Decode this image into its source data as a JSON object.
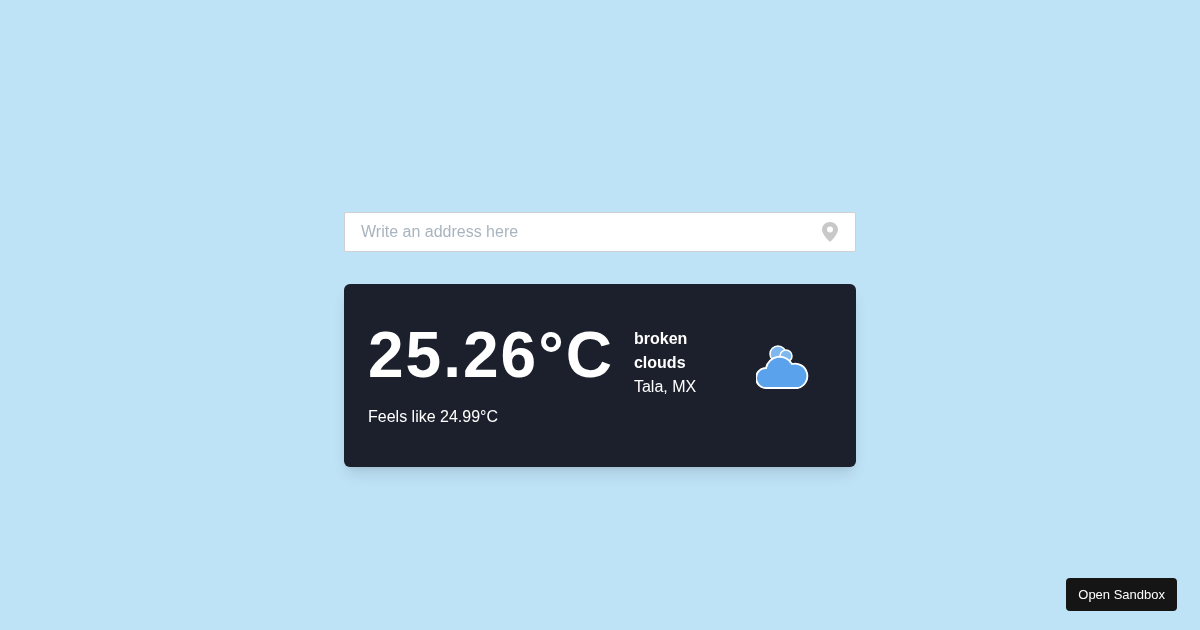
{
  "search": {
    "placeholder": "Write an address here"
  },
  "weather": {
    "temperature": "25.26°C",
    "feels_like": "Feels like 24.99°C",
    "description": "broken clouds",
    "location": "Tala, MX"
  },
  "sandbox_button": "Open Sandbox"
}
